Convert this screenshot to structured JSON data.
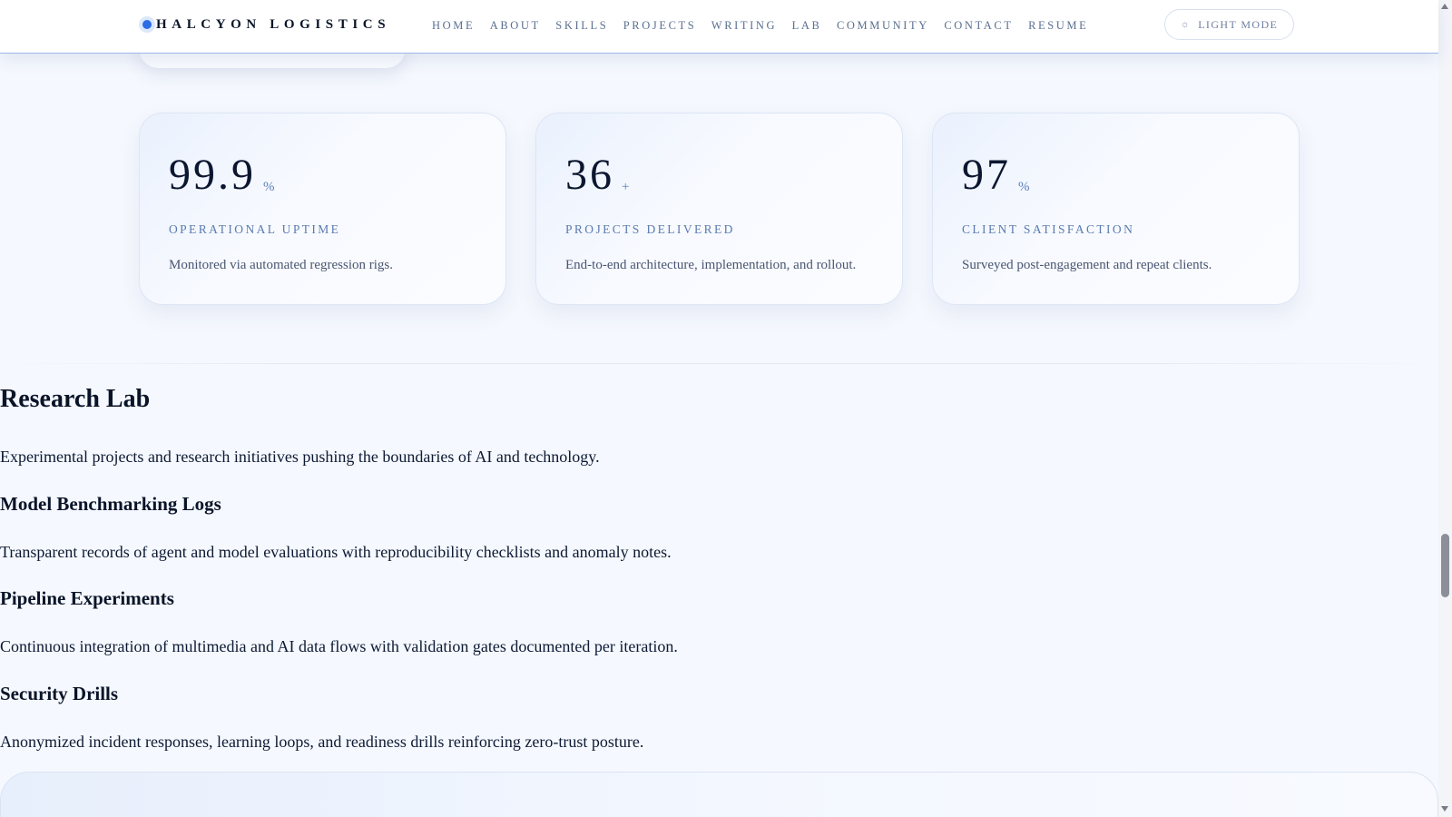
{
  "header": {
    "brand": "HALCYON LOGISTICS",
    "nav": [
      "HOME",
      "ABOUT",
      "SKILLS",
      "PROJECTS",
      "WRITING",
      "LAB",
      "COMMUNITY",
      "CONTACT",
      "RESUME"
    ],
    "theme_toggle": "LIGHT MODE",
    "theme_icon": "☼"
  },
  "stats": [
    {
      "value": "99.9",
      "suffix": "%",
      "label": "OPERATIONAL UPTIME",
      "desc": "Monitored via automated regression rigs."
    },
    {
      "value": "36",
      "suffix": "+",
      "label": "PROJECTS DELIVERED",
      "desc": "End-to-end architecture, implementation, and rollout."
    },
    {
      "value": "97",
      "suffix": "%",
      "label": "CLIENT SATISFACTION",
      "desc": "Surveyed post-engagement and repeat clients."
    }
  ],
  "lab": {
    "title": "Research Lab",
    "intro": "Experimental projects and research initiatives pushing the boundaries of AI and technology.",
    "items": [
      {
        "title": "Model Benchmarking Logs",
        "desc": "Transparent records of agent and model evaluations with reproducibility checklists and anomaly notes."
      },
      {
        "title": "Pipeline Experiments",
        "desc": "Continuous integration of multimedia and AI data flows with validation gates documented per iteration."
      },
      {
        "title": "Security Drills",
        "desc": "Anonymized incident responses, learning loops, and readiness drills reinforcing zero-trust posture."
      }
    ]
  },
  "colors": {
    "accent": "#2b6be6",
    "nav_text": "#5a6f91",
    "label_text": "#5a7bb0",
    "page_bg": "#f5f8fe"
  }
}
